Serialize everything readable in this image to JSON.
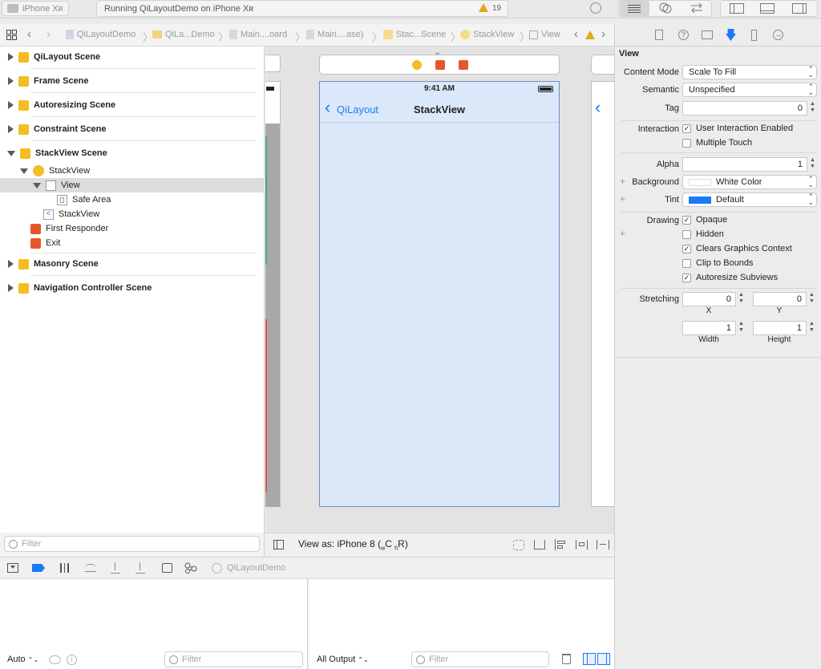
{
  "toolbar": {
    "scheme_device": "iPhone Xʀ",
    "status": "Running QiLayoutDemo on iPhone Xʀ",
    "warning_count": "19"
  },
  "jumpbar": {
    "crumbs": [
      "QiLayoutDemo",
      "QiLa...Demo",
      "Main....oard",
      "Main....ase)",
      "Stac...Scene",
      "StackView",
      "View"
    ]
  },
  "navigator": {
    "scenes": [
      "QiLayout Scene",
      "Frame Scene",
      "Autoresizing Scene",
      "Constraint Scene",
      "StackView Scene",
      "Masonry Scene",
      "Navigation Controller Scene"
    ],
    "tree": {
      "controller": "StackView",
      "view": "View",
      "safe_area": "Safe Area",
      "nav_item": "StackView",
      "first_responder": "First Responder",
      "exit": "Exit"
    },
    "filter_placeholder": "Filter"
  },
  "canvas": {
    "status_time": "9:41 AM",
    "back_label": "QiLayout",
    "nav_title": "StackView",
    "view_as": "View as: iPhone 8 (",
    "size_w": "C",
    "size_h": "R)",
    "size_prefix_w": "w",
    "size_prefix_h": "h"
  },
  "debug": {
    "target": "QiLayoutDemo",
    "auto_label": "Auto",
    "output_label": "All Output",
    "filter_placeholder": "Filter"
  },
  "inspector": {
    "section": "View",
    "content_mode_label": "Content Mode",
    "content_mode": "Scale To Fill",
    "semantic_label": "Semantic",
    "semantic": "Unspecified",
    "tag_label": "Tag",
    "tag": "0",
    "interaction_label": "Interaction",
    "user_interaction": "User Interaction Enabled",
    "multiple_touch": "Multiple Touch",
    "alpha_label": "Alpha",
    "alpha": "1",
    "background_label": "Background",
    "background": "White Color",
    "tint_label": "Tint",
    "tint": "Default",
    "drawing_label": "Drawing",
    "opaque": "Opaque",
    "hidden": "Hidden",
    "clears": "Clears Graphics Context",
    "clip": "Clip to Bounds",
    "autoresize": "Autoresize Subviews",
    "stretching_label": "Stretching",
    "stretch_x": "0",
    "stretch_y": "0",
    "stretch_w": "1",
    "stretch_h": "1",
    "x_label": "X",
    "y_label": "Y",
    "width_label": "Width",
    "height_label": "Height",
    "checks": {
      "user_interaction": true,
      "multiple_touch": false,
      "opaque": true,
      "hidden": false,
      "clears": true,
      "clip": false,
      "autoresize": true
    }
  },
  "colors": {
    "accent": "#1a7cf5",
    "scene_icon": "#f4bd22",
    "canvas_view": "#dae8fa",
    "exit_red": "#e5562b"
  }
}
